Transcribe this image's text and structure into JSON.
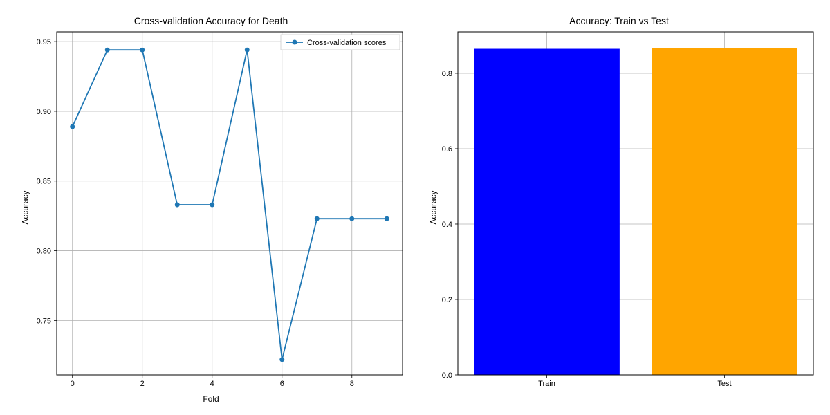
{
  "chart_data": [
    {
      "type": "line",
      "title": "Cross-validation Accuracy for Death",
      "xlabel": "Fold",
      "ylabel": "Accuracy",
      "xlim": [
        -0.45,
        9.45
      ],
      "ylim": [
        0.711,
        0.957
      ],
      "xticks": [
        0,
        2,
        4,
        6,
        8
      ],
      "yticks": [
        0.75,
        0.8,
        0.85,
        0.9,
        0.95
      ],
      "ytick_labels": [
        "0.75",
        "0.80",
        "0.85",
        "0.90",
        "0.95"
      ],
      "legend": "Cross-validation scores",
      "x": [
        0,
        1,
        2,
        3,
        4,
        5,
        6,
        7,
        8,
        9
      ],
      "values": [
        0.889,
        0.944,
        0.944,
        0.833,
        0.833,
        0.944,
        0.722,
        0.823,
        0.823,
        0.823
      ]
    },
    {
      "type": "bar",
      "title": "Accuracy: Train vs Test",
      "xlabel": "",
      "ylabel": "Accuracy",
      "ylim": [
        0.0,
        0.91
      ],
      "yticks": [
        0.0,
        0.2,
        0.4,
        0.6,
        0.8
      ],
      "ytick_labels": [
        "0.0",
        "0.2",
        "0.4",
        "0.6",
        "0.8"
      ],
      "categories": [
        "Train",
        "Test"
      ],
      "values": [
        0.865,
        0.867
      ],
      "colors": [
        "#0000ff",
        "#ffa500"
      ]
    }
  ]
}
